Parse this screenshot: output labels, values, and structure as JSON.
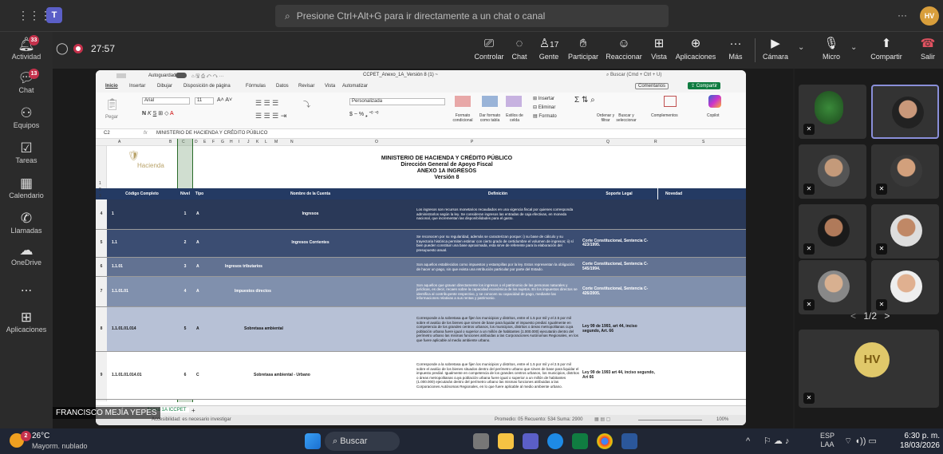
{
  "app": {
    "search_placeholder": "Presione Ctrl+Alt+G para ir directamente a un chat o canal",
    "user_initials": "HV",
    "more": "···"
  },
  "rail": [
    {
      "label": "Actividad",
      "badge": "33",
      "icon": "bell-icon"
    },
    {
      "label": "Chat",
      "badge": "13",
      "icon": "chat-icon"
    },
    {
      "label": "Equipos",
      "icon": "teams-icon"
    },
    {
      "label": "Tareas",
      "icon": "tasks-icon"
    },
    {
      "label": "Calendario",
      "icon": "calendar-icon"
    },
    {
      "label": "Llamadas",
      "icon": "phone-icon"
    },
    {
      "label": "OneDrive",
      "icon": "cloud-icon"
    },
    {
      "label": "...",
      "icon": "more-icon"
    },
    {
      "label": "Aplicaciones",
      "icon": "apps-icon"
    }
  ],
  "meeting": {
    "timer": "27:57",
    "people_count": "17",
    "buttons": {
      "controlar": "Controlar",
      "chat": "Chat",
      "gente": "Gente",
      "participar": "Participar",
      "reaccionar": "Reaccionar",
      "vista": "Vista",
      "aplicaciones": "Aplicaciones",
      "mas": "Más",
      "camara": "Cámara",
      "micro": "Micro",
      "compartir": "Compartir",
      "salir": "Salir"
    }
  },
  "excel": {
    "autosave": "Autoguardado",
    "filename": "CCPET_Anexo_1A_Versión 8 (1) ~",
    "search": "Buscar (Cmd + Ctrl + U)",
    "tabs": [
      "Inicio",
      "Insertar",
      "Dibujar",
      "Disposición de página",
      "Fórmulas",
      "Datos",
      "Revisar",
      "Vista",
      "Automatizar"
    ],
    "comentarios": "Comentarios",
    "compartir": "Compartir",
    "font": "Arial",
    "font_size": "11",
    "number_format": "Personalizada",
    "pegar": "Pegar",
    "ribbon_labels": {
      "formato": "Formato condicional",
      "dar_formato": "Dar formato como tabla",
      "estilos": "Estilos de celda",
      "insertar": "Insertar",
      "eliminar": "Eliminar",
      "formato_cells": "Formato",
      "ordenar": "Ordenar y filtrar",
      "buscar": "Buscar y seleccionar",
      "complementos": "Complementos",
      "copilot": "Copilot"
    },
    "cell_ref": "C2",
    "fx": "fx",
    "formula": "MINISTERIO DE HACIENDA Y CRÉDITO PÚBLICO",
    "col_letters": [
      "A",
      "B",
      "C",
      "D",
      "E",
      "F",
      "G",
      "H",
      "I",
      "J",
      "K",
      "L",
      "M",
      "N",
      "O",
      "P",
      "Q",
      "R",
      "S"
    ],
    "logo_text": "Hacienda",
    "title1": "MINISTERIO DE HACIENDA Y CRÉDITO PÚBLICO",
    "title2": "Dirección General de Apoyo Fiscal",
    "title3": "ANEXO 1A INGRESOS",
    "title4": "Versión 8",
    "headers": [
      "Código Completo",
      "Nivel",
      "Tipo",
      "Nombre de la Cuenta",
      "Definición",
      "Soporte Legal",
      "Novedad"
    ],
    "rows": [
      {
        "num": "4",
        "code": "1",
        "nivel": "1",
        "tipo": "A",
        "name": "Ingresos",
        "def": "Los ingresos son recursos monetarios recaudados en una vigencia fiscal por quienes corresponda administrarlos según la ley. Se consideran ingresos las entradas de caja efectivas, en moneda nacional, que incrementan las disponibilidades para el gasto.",
        "legal": ""
      },
      {
        "num": "5",
        "code": "1.1",
        "nivel": "2",
        "tipo": "A",
        "name": "Ingresos Corrientes",
        "def": "Se reconocen por su regularidad, además se caracterizan porque: i) su base de cálculo y su trayectoria histórica permiten estimar con cierto grado de certidumbre el volumen de ingresos; ii) sí bien pueden constituir una base aproximada, esta sirve de referente para la elaboración del presupuesto anual.",
        "legal": "Corte Constitucional, Sentencia C-423/1995."
      },
      {
        "num": "6",
        "code": "1.1.01",
        "nivel": "3",
        "tipo": "A",
        "name": "Ingresos tributarios",
        "def": "Son aquellos establecidos como impuestos y estampillas por la ley. Estos representan la obligación de hacer un pago, sin que exista una retribución particular por parte del Estado.",
        "legal": "Corte Constitucional, Sentencia C-545/1994."
      },
      {
        "num": "7",
        "code": "1.1.01.01",
        "nivel": "4",
        "tipo": "A",
        "name": "Impuestos directos",
        "def": "Son aquellos que gravan directamente los ingresos o el patrimonio de las personas naturales y jurídicas, es decir, recaen sobre la capacidad económica de los sujetos. En los impuestos directos se identifica al contribuyente respectivo, y se conocen su capacidad de pago, mediante las informaciones relativas a sus rentas y patrimonio.",
        "legal": "Corte Constitucional, Sentencia C-426/2005."
      },
      {
        "num": "8",
        "code": "1.1.01.01.014",
        "nivel": "5",
        "tipo": "A",
        "name": "Sobretasa ambiental",
        "def": "Corresponde a la sobretasa que fijen los municipios y distritos, entre el 1.5 por mil y el 2.5 por mil sobre el avalúo de los bienes que sirven de base para liquidar el impuesto predial. Igualmente en competencia de los grandes centros urbanos, los municipios, distritos o áreas metropolitanas cuya población urbana fuere igual o superior a un millón de habitantes (1.000.000) ejecutarán dentro del perímetro urbano las mismas funciones atribuidas a las Corporaciones Autónomas Regionales, en los que fuere aplicable al medio ambiente urbano.",
        "legal": "Ley 99 de 1993, art 44, inciso segundo, Art. 66"
      },
      {
        "num": "9",
        "code": "1.1.01.01.014.01",
        "nivel": "6",
        "tipo": "C",
        "name": "Sobretasa ambiental - Urbano",
        "def": "Corresponde a la sobretasa que fijen los municipios y distritos, entre el 1.5 por mil y el 2.5 por mil sobre el avalúo de los bienes situados dentro del perímetro urbano que sirven de base para liquidar el impuesto predial. Igualmente en competencia de los grandes centros urbanos, los municipios, distritos o áreas metropolitanas cuya población urbana fuere igual o superior a un millón de habitantes (1.000.000) ejecutarán dentro del perímetro urbano las mismas funciones atribuidas a las Corporaciones Autónomas Regionales, en lo que fuere aplicable al medio ambiente urbano.",
        "legal": "Ley 99 de 1993 art 44, inciso segundo, Art 66"
      }
    ],
    "sheet_tab": "Anexo 1A ICCPET",
    "status_left": "Accesibilidad: es necesario investigar",
    "status_right": "Promedio: 05   Recuento: 534   Suma: 2900",
    "zoom": "100%"
  },
  "presenter_name": "FRANCISCO MEJÍA YEPES",
  "gallery": {
    "page": "1/2",
    "prev": "<",
    "next": ">",
    "self_initials": "HV"
  },
  "taskbar": {
    "weather_temp": "26°C",
    "weather_desc": "Mayorm. nublado",
    "weather_badge": "2",
    "search": "Buscar",
    "lang1": "ESP",
    "lang2": "LAA",
    "time": "6:30 p. m.",
    "date": "18/03/2026"
  }
}
